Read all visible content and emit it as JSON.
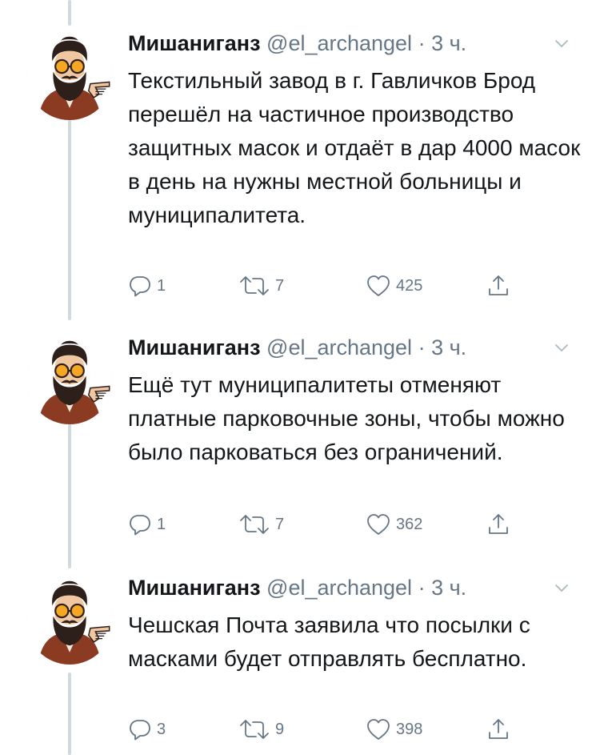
{
  "tweets": [
    {
      "name": "Мишаниганз",
      "handle": "@el_archangel",
      "dot": "·",
      "time": "3 ч.",
      "text": "Текстильный завод в г. Гавличков Брод перешёл на частичное производство защитных масок и отдаёт в дар 4000 масок в день на нужны местной больницы и муниципалитета.",
      "replies": "1",
      "retweets": "7",
      "likes": "425"
    },
    {
      "name": "Мишаниганз",
      "handle": "@el_archangel",
      "dot": "·",
      "time": "3 ч.",
      "text": "Ещё тут муниципалитеты отменяют платные парковочные зоны, чтобы можно было парковаться без ограничений.",
      "replies": "1",
      "retweets": "7",
      "likes": "362"
    },
    {
      "name": "Мишаниганз",
      "handle": "@el_archangel",
      "dot": "·",
      "time": "3 ч.",
      "text": "Чешская Почта заявила что посылки с масками будет отправлять бесплатно.",
      "replies": "3",
      "retweets": "9",
      "likes": "398"
    }
  ],
  "icons": {
    "reply": "reply-icon",
    "retweet": "retweet-icon",
    "like": "heart-icon",
    "share": "share-icon",
    "more": "chevron-down-icon"
  },
  "colors": {
    "text": "#14171a",
    "secondary": "#657786",
    "thread_line": "#cfd9de"
  }
}
